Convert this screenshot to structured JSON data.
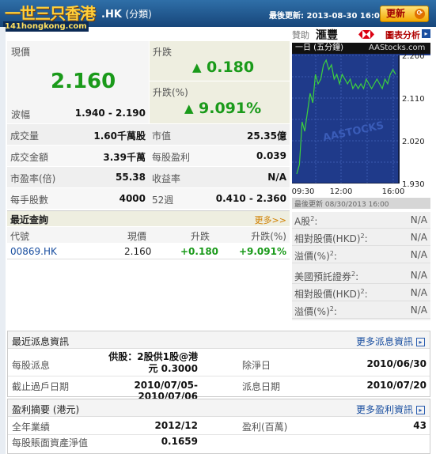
{
  "header": {
    "logo_text": "一世三只香港",
    "logo_sub": "141hongkong.com",
    "ticker": ".HK",
    "ticker_suffix": "(分類)",
    "last_update": "最後更新: 2013-08-30 16:01",
    "refresh_label": "更新"
  },
  "sponsor": {
    "prefix": "贊助",
    "bank": "滙豐",
    "link": "圖表分析"
  },
  "quote": {
    "price_label": "現價",
    "price": "2.160",
    "range_label": "波幅",
    "range": "1.940 - 2.190",
    "change_label": "升跌",
    "change": "0.180",
    "change_pct_label": "升跌(%)",
    "change_pct": "9.091%"
  },
  "stats": [
    {
      "label": "成交量",
      "value": "1.60千萬股",
      "label2": "市值",
      "value2": "25.35億"
    },
    {
      "label": "成交金額",
      "value": "3.39千萬",
      "label2": "每股盈利",
      "value2": "0.039"
    },
    {
      "label": "市盈率(倍)",
      "value": "55.38",
      "label2": "收益率",
      "value2": "N/A"
    },
    {
      "label": "每手股數",
      "value": "4000",
      "label2": "52週",
      "value2": "0.410 - 2.360"
    }
  ],
  "chart": {
    "title": "一日 (五分鐘)",
    "source": "AAStocks.com",
    "watermark": "AASTOCKS",
    "y_ticks": [
      "2.200",
      "2.110",
      "2.020",
      "1.930"
    ],
    "x_ticks": [
      "09:30",
      "12:00",
      "16:00"
    ],
    "footer": "最後更新 08/30/2013 16:00"
  },
  "chart_data": {
    "type": "line",
    "title": "一日 (五分鐘)",
    "ylim": [
      1.93,
      2.2
    ],
    "x_ticks": [
      "09:30",
      "12:00",
      "16:00"
    ],
    "series": [
      {
        "values": [
          1.95,
          1.97,
          2.06,
          2.04,
          2.08,
          2.12,
          2.1,
          2.16,
          2.14,
          2.15,
          2.18,
          2.19,
          2.17,
          2.18,
          2.15,
          2.16,
          2.14,
          2.16,
          2.15,
          2.14,
          2.15,
          2.13,
          2.14,
          2.13,
          2.14,
          2.13,
          2.15,
          2.14,
          2.13,
          2.14,
          2.15,
          2.14,
          2.13,
          2.15,
          2.14,
          2.16,
          2.17,
          2.16
        ]
      }
    ]
  },
  "recent": {
    "title": "最近查詢",
    "more": "更多>>",
    "columns": [
      "代號",
      "現價",
      "升跌",
      "升跌(%)"
    ],
    "rows": [
      {
        "code": "00869.HK",
        "price": "2.160",
        "change": "+0.180",
        "pct": "+9.091%"
      }
    ]
  },
  "side": [
    {
      "label": "A股",
      "sup": "2",
      "value": "N/A"
    },
    {
      "label": "相對股價(HKD)",
      "sup": "2",
      "value": "N/A"
    },
    {
      "label": "溢價(%)",
      "sup": "2",
      "value": "N/A"
    },
    {
      "label": "美國預託證券",
      "sup": "2",
      "value": "N/A"
    },
    {
      "label": "相對股價(HKD)",
      "sup": "2",
      "value": "N/A"
    },
    {
      "label": "溢價(%)",
      "sup": "2",
      "value": "N/A"
    }
  ],
  "dividend": {
    "title": "最近派息資訊",
    "more": "更多派息資訊",
    "per_share_label": "每股派息",
    "per_share_value": "供股：2股供1股@港元 0.3000",
    "ex_date_label": "除淨日",
    "ex_date": "2010/06/30",
    "book_close_label": "截止過戶日期",
    "book_close": "2010/07/05-2010/07/06",
    "pay_date_label": "派息日期",
    "pay_date": "2010/07/20"
  },
  "profit": {
    "title": "盈利摘要",
    "unit": "(港元)",
    "more": "更多盈利資訊",
    "year_label": "全年業績",
    "year": "2012/12",
    "profit_label": "盈利(百萬)",
    "profit_value": "43",
    "nav_label": "每股賬面資產淨值",
    "nav": "0.1659"
  }
}
